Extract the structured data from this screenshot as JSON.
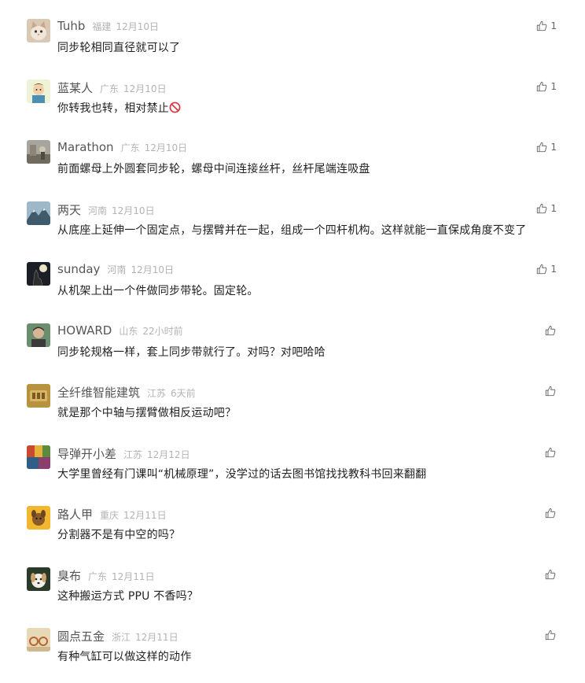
{
  "comments": [
    {
      "nick": "Tuhb",
      "location": "福建",
      "time": "12月10日",
      "text": "同步轮相同直径就可以了",
      "likes": "1",
      "avatar": "cat-avatar"
    },
    {
      "nick": "蓝某人",
      "location": "广东",
      "time": "12月10日",
      "text": "你转我也转，相对禁止",
      "emoji": "no-entry-emoji",
      "likes": "1",
      "avatar": "cartoon-avatar"
    },
    {
      "nick": "Marathon",
      "location": "广东",
      "time": "12月10日",
      "text": "前面螺母上外圆套同步轮，螺母中间连接丝杆，丝杆尾端连吸盘",
      "likes": "1",
      "avatar": "photo-avatar"
    },
    {
      "nick": "两天",
      "location": "河南",
      "time": "12月10日",
      "text": "从底座上延伸一个固定点，与摆臂并在一起，组成一个四杆机构。这样就能一直保成角度不变了",
      "likes": "1",
      "avatar": "mountain-avatar"
    },
    {
      "nick": "sunday",
      "location": "河南",
      "time": "12月10日",
      "text": "从机架上出一个件做同步带轮。固定轮。",
      "likes": "1",
      "avatar": "wolf-avatar"
    },
    {
      "nick": "HOWARD",
      "location": "山东",
      "time": "22小时前",
      "text": "同步轮规格一样，套上同步带就行了。对吗？对吧哈哈",
      "likes": "",
      "avatar": "person-avatar"
    },
    {
      "nick": "全纤维智能建筑",
      "location": "江苏",
      "time": "6天前",
      "text": "就是那个中轴与摆臂做相反运动吧？",
      "likes": "",
      "avatar": "logo-avatar"
    },
    {
      "nick": "导弹开小差",
      "location": "江苏",
      "time": "12月12日",
      "text": "大学里曾经有门课叫“机械原理”，没学过的话去图书馆找找教科书回来翻翻",
      "likes": "",
      "avatar": "colorful-avatar"
    },
    {
      "nick": "路人甲",
      "location": "重庆",
      "time": "12月11日",
      "text": "分割器不是有中空的吗？",
      "likes": "",
      "avatar": "dog-cartoon-avatar"
    },
    {
      "nick": "臭布",
      "location": "广东",
      "time": "12月11日",
      "text": "这种搬运方式 PPU 不香吗？",
      "likes": "",
      "avatar": "puppy-avatar"
    },
    {
      "nick": "圆点五金",
      "location": "浙江",
      "time": "12月11日",
      "text": "有种气缸可以做这样的动作",
      "likes": "",
      "avatar": "glasses-avatar"
    }
  ],
  "icons": {
    "like": "thumbs-up-icon"
  },
  "colors": {
    "nick": "#555555",
    "meta": "#b3b3b3",
    "text": "#222222"
  }
}
